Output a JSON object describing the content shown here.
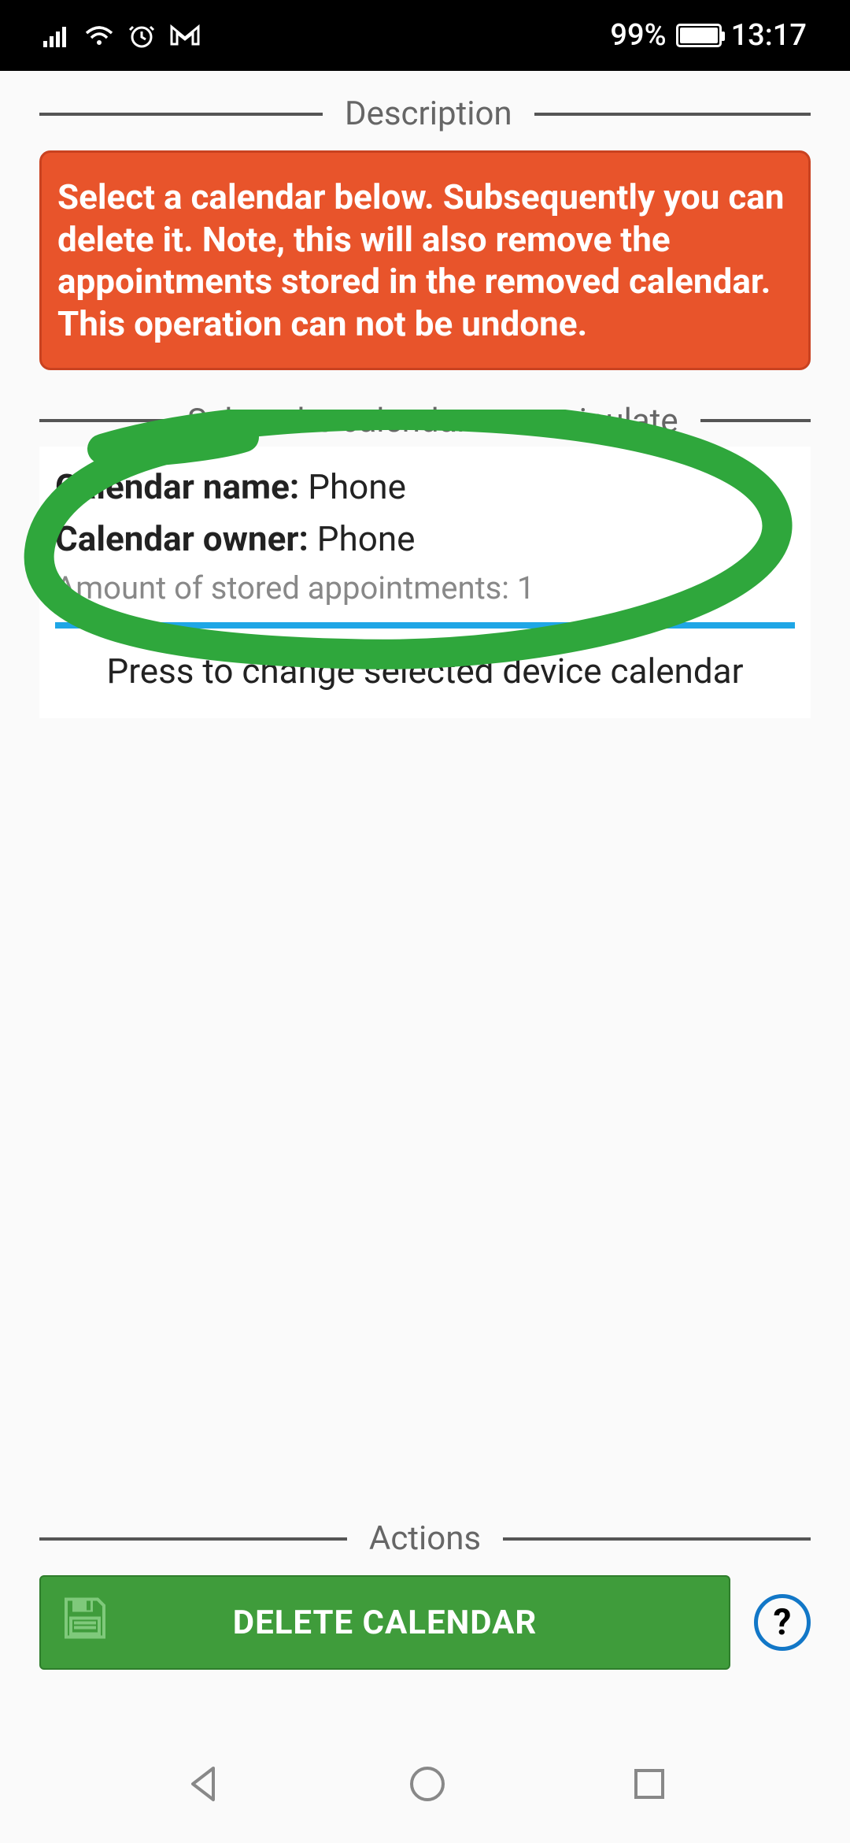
{
  "status": {
    "battery_pct": "99%",
    "time": "13:17"
  },
  "description": {
    "legend": "Description",
    "warning": "Select a calendar below. Subsequently you can delete it. Note, this will also remove the appointments stored in the removed calendar. This operation can not be undone."
  },
  "selectCalendar": {
    "legend": "Select the calendar to manipulate",
    "nameLabel": "Calendar name:",
    "nameValue": "Phone",
    "ownerLabel": "Calendar owner:",
    "ownerValue": "Phone",
    "amountLabel": "Amount of stored appointments:",
    "amountValue": "1",
    "pressHint": "Press to change selected device calendar"
  },
  "actions": {
    "legend": "Actions",
    "deleteLabel": "DELETE CALENDAR",
    "helpLabel": "?"
  },
  "annotation": {
    "color": "#2fa73c"
  }
}
